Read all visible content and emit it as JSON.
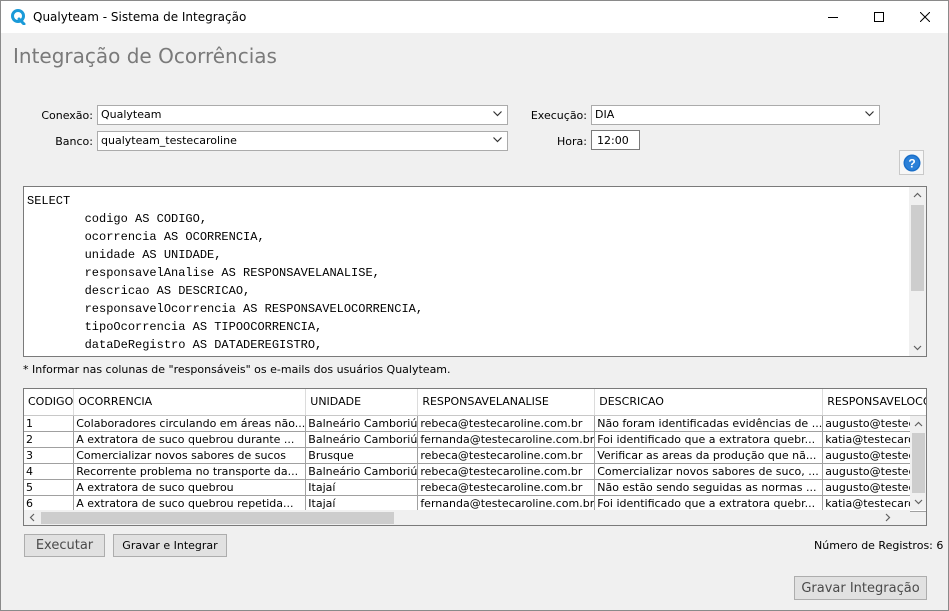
{
  "window": {
    "title": "Qualyteam - Sistema de Integração"
  },
  "page": {
    "title": "Integração de Ocorrências"
  },
  "form": {
    "conexao_label": "Conexão:",
    "conexao_value": "Qualyteam",
    "banco_label": "Banco:",
    "banco_value": "qualyteam_testecaroline",
    "execucao_label": "Execução:",
    "execucao_value": "DIA",
    "hora_label": "Hora:",
    "hora_value": "12:00"
  },
  "sql": {
    "text": "SELECT\n        codigo AS CODIGO,\n        ocorrencia AS OCORRENCIA,\n        unidade AS UNIDADE,\n        responsavelAnalise AS RESPONSAVELANALISE,\n        descricao AS DESCRICAO,\n        responsavelOcorrencia AS RESPONSAVELOCORRENCIA,\n        tipoOcorrencia AS TIPOOCORRENCIA,\n        dataDeRegistro AS DATADEREGISTRO,"
  },
  "note": "* Informar nas colunas de \"responsáveis\" os e-mails dos usuários Qualyteam.",
  "grid": {
    "columns": [
      "CODIGO",
      "OCORRENCIA",
      "UNIDADE",
      "RESPONSAVELANALISE",
      "DESCRICAO",
      "RESPONSAVELOCORRENCIA"
    ],
    "rows": [
      [
        "1",
        "Colaboradores circulando em áreas não...",
        "Balneário Camboriú",
        "rebeca@testecaroline.com.br",
        "Não foram identificadas evidências de ...",
        "augusto@testecaroline.com.br"
      ],
      [
        "2",
        "A extratora de suco quebrou durante ...",
        "Balneário Camboriú",
        "fernanda@testecaroline.com.br",
        "Foi identificado que a extratora quebr...",
        "katia@testecaroline.com.br"
      ],
      [
        "3",
        "Comercializar novos sabores de sucos",
        "Brusque",
        "rebeca@testecaroline.com.br",
        "Verificar as areas da produção que nã...",
        "augusto@testecaroline.com.br"
      ],
      [
        "4",
        "Recorrente problema no transporte da...",
        "Balneário Camboriú",
        "rebeca@testecaroline.com.br",
        "Comercializar novos sabores de suco, ...",
        "augusto@testecaroline.com.br"
      ],
      [
        "5",
        "A extratora de suco quebrou",
        "Itajaí",
        "rebeca@testecaroline.com.br",
        "Não estão sendo seguidas as normas ...",
        "augusto@testecaroline.com.br"
      ],
      [
        "6",
        "A extratora de suco quebrou repetida...",
        "Itajaí",
        "fernanda@testecaroline.com.br",
        "Foi identificado que a extratora quebr...",
        "katia@testecaroline.com.br"
      ]
    ]
  },
  "buttons": {
    "executar": "Executar",
    "gravar_integrar": "Gravar e Integrar",
    "gravar_integracao": "Gravar Integração"
  },
  "status": {
    "registros": "Número de Registros: 6"
  },
  "colors": {
    "accent": "#1a6fc9",
    "title_gray": "#7a7a7a",
    "background": "#f0f0f0"
  },
  "icons": [
    "qualyteam-logo-icon",
    "minimize-icon",
    "maximize-icon",
    "close-icon",
    "chevron-down-icon",
    "help-icon"
  ]
}
